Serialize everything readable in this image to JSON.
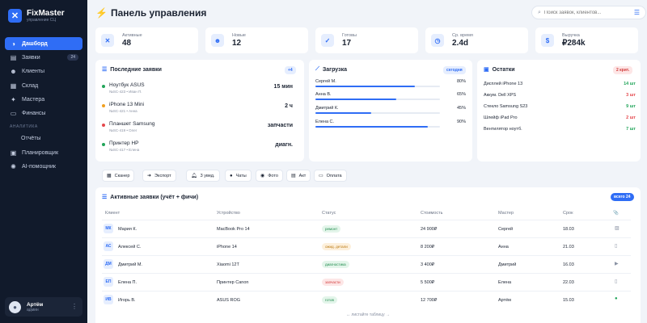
{
  "brand": {
    "name": "FixMaster",
    "sub": "управление СЦ"
  },
  "sidebar": {
    "items": [
      {
        "label": "Дашборд",
        "icon": "dashboard-icon",
        "active": true
      },
      {
        "label": "Заявки",
        "icon": "requests-icon",
        "badge": "24"
      },
      {
        "label": "Клиенты",
        "icon": "clients-icon"
      },
      {
        "label": "Склад",
        "icon": "warehouse-icon"
      },
      {
        "label": "Мастера",
        "icon": "masters-icon"
      },
      {
        "label": "Финансы",
        "icon": "finance-icon"
      }
    ],
    "section": "АНАЛИТИКА",
    "items2": [
      {
        "label": "Отчёты",
        "icon": ""
      },
      {
        "label": "Планировщик",
        "icon": "planner-icon"
      },
      {
        "label": "AI-помощник",
        "icon": "ai-icon"
      }
    ]
  },
  "user": {
    "name": "Артём",
    "role": "админ"
  },
  "header": {
    "title": "Панель управления",
    "search_placeholder": "Поиск заявок, клиентов..."
  },
  "stats": [
    {
      "label": "Активные",
      "value": "48",
      "icon": "wrench-icon"
    },
    {
      "label": "Новые",
      "value": "12",
      "icon": "user-plus-icon"
    },
    {
      "label": "Готовы",
      "value": "17",
      "icon": "check-icon"
    },
    {
      "label": "Ср. время",
      "value": "2.4d",
      "icon": "clock-icon"
    },
    {
      "label": "Выручка",
      "value": "₽284k",
      "icon": "dollar-icon"
    }
  ],
  "recent": {
    "title": "Последние заявки",
    "pill": "+4",
    "items": [
      {
        "title": "Ноутбук ASUS",
        "sub": "№SC-423 • Иван П.",
        "right": "15 мин",
        "color": "#22a55a"
      },
      {
        "title": "iPhone 13 Mini",
        "sub": "№SC-421 • Анна",
        "right": "2 ч",
        "color": "#f0a020"
      },
      {
        "title": "Планшет Samsung",
        "sub": "№SC-419 • Олег",
        "right": "запчасти",
        "color": "#e5484d"
      },
      {
        "title": "Принтер HP",
        "sub": "№SC-417 • Елена",
        "right": "диагн.",
        "color": "#22a55a"
      }
    ]
  },
  "load": {
    "title": "Загрузка",
    "pill": "сегодня",
    "items": [
      {
        "name": "Сергей М.",
        "pct": "80%",
        "value": 0.8
      },
      {
        "name": "Анна В.",
        "pct": "65%",
        "value": 0.65
      },
      {
        "name": "Дмитрий К.",
        "pct": "45%",
        "value": 0.45
      },
      {
        "name": "Елена С.",
        "pct": "90%",
        "value": 0.9
      }
    ]
  },
  "stock": {
    "title": "Остатки",
    "pill": "2 крит.",
    "items": [
      {
        "name": "Дисплей iPhone 13",
        "qty": "14 шт",
        "color": "#22a55a"
      },
      {
        "name": "Аккум. Dell XPS",
        "qty": "3 шт",
        "color": "#e5484d"
      },
      {
        "name": "Стекло Samsung S23",
        "qty": "9 шт",
        "color": "#22a55a"
      },
      {
        "name": "Шлейф iPad Pro",
        "qty": "2 шт",
        "color": "#e5484d"
      },
      {
        "name": "Вентилятор ноутб.",
        "qty": "7 шт",
        "color": "#22a55a"
      }
    ]
  },
  "toolbar": [
    {
      "label": "Сканер",
      "icon": "scanner-icon"
    },
    {
      "label": "Экспорт",
      "icon": "export-icon"
    },
    {
      "label": "3 увед.",
      "icon": "bell-icon"
    },
    {
      "label": "Чаты",
      "icon": "chat-icon"
    },
    {
      "label": "Фото",
      "icon": "camera-icon"
    },
    {
      "label": "Акт",
      "icon": "print-icon"
    },
    {
      "label": "Оплата",
      "icon": "card-icon"
    }
  ],
  "table": {
    "title": "Активные заявки (учёт + фичи)",
    "pill": "всего 24",
    "columns": [
      "Клиент",
      "Устройство",
      "Статус",
      "Стоимость",
      "Мастер",
      "Срок",
      "📎"
    ],
    "rows": [
      {
        "initials": "МК",
        "client": "Мария К.",
        "device": "MacBook Pro 14",
        "status": "ремонт",
        "status_bg": "#e3f5ea",
        "status_fg": "#1f8a4c",
        "cost": "24 900₽",
        "master": "Сергей",
        "date": "18.03",
        "icon": "image-icon"
      },
      {
        "initials": "АС",
        "client": "Алексей С.",
        "device": "iPhone 14",
        "status": "ожид. детали",
        "status_bg": "#fdf0dc",
        "status_fg": "#b9770e",
        "cost": "8 200₽",
        "master": "Анна",
        "date": "21.03",
        "icon": "doc-icon"
      },
      {
        "initials": "ДМ",
        "client": "Дмитрий М.",
        "device": "Xiaomi 12T",
        "status": "диагностика",
        "status_bg": "#e3f5ea",
        "status_fg": "#1f8a4c",
        "cost": "3 400₽",
        "master": "Дмитрий",
        "date": "16.03",
        "icon": "video-icon"
      },
      {
        "initials": "ЕП",
        "client": "Елена П.",
        "device": "Принтер Canon",
        "status": "запчасти",
        "status_bg": "#fde6e6",
        "status_fg": "#d13b3b",
        "cost": "5 500₽",
        "master": "Елена",
        "date": "22.03",
        "icon": "doc-icon"
      },
      {
        "initials": "ИВ",
        "client": "Игорь В.",
        "device": "ASUS ROG",
        "status": "готов",
        "status_bg": "#e3f5ea",
        "status_fg": "#1f8a4c",
        "cost": "12 700₽",
        "master": "Артём",
        "date": "15.03",
        "icon": "check-circle-icon"
      }
    ],
    "scroll_hint": "↔ листайте таблицу →"
  }
}
